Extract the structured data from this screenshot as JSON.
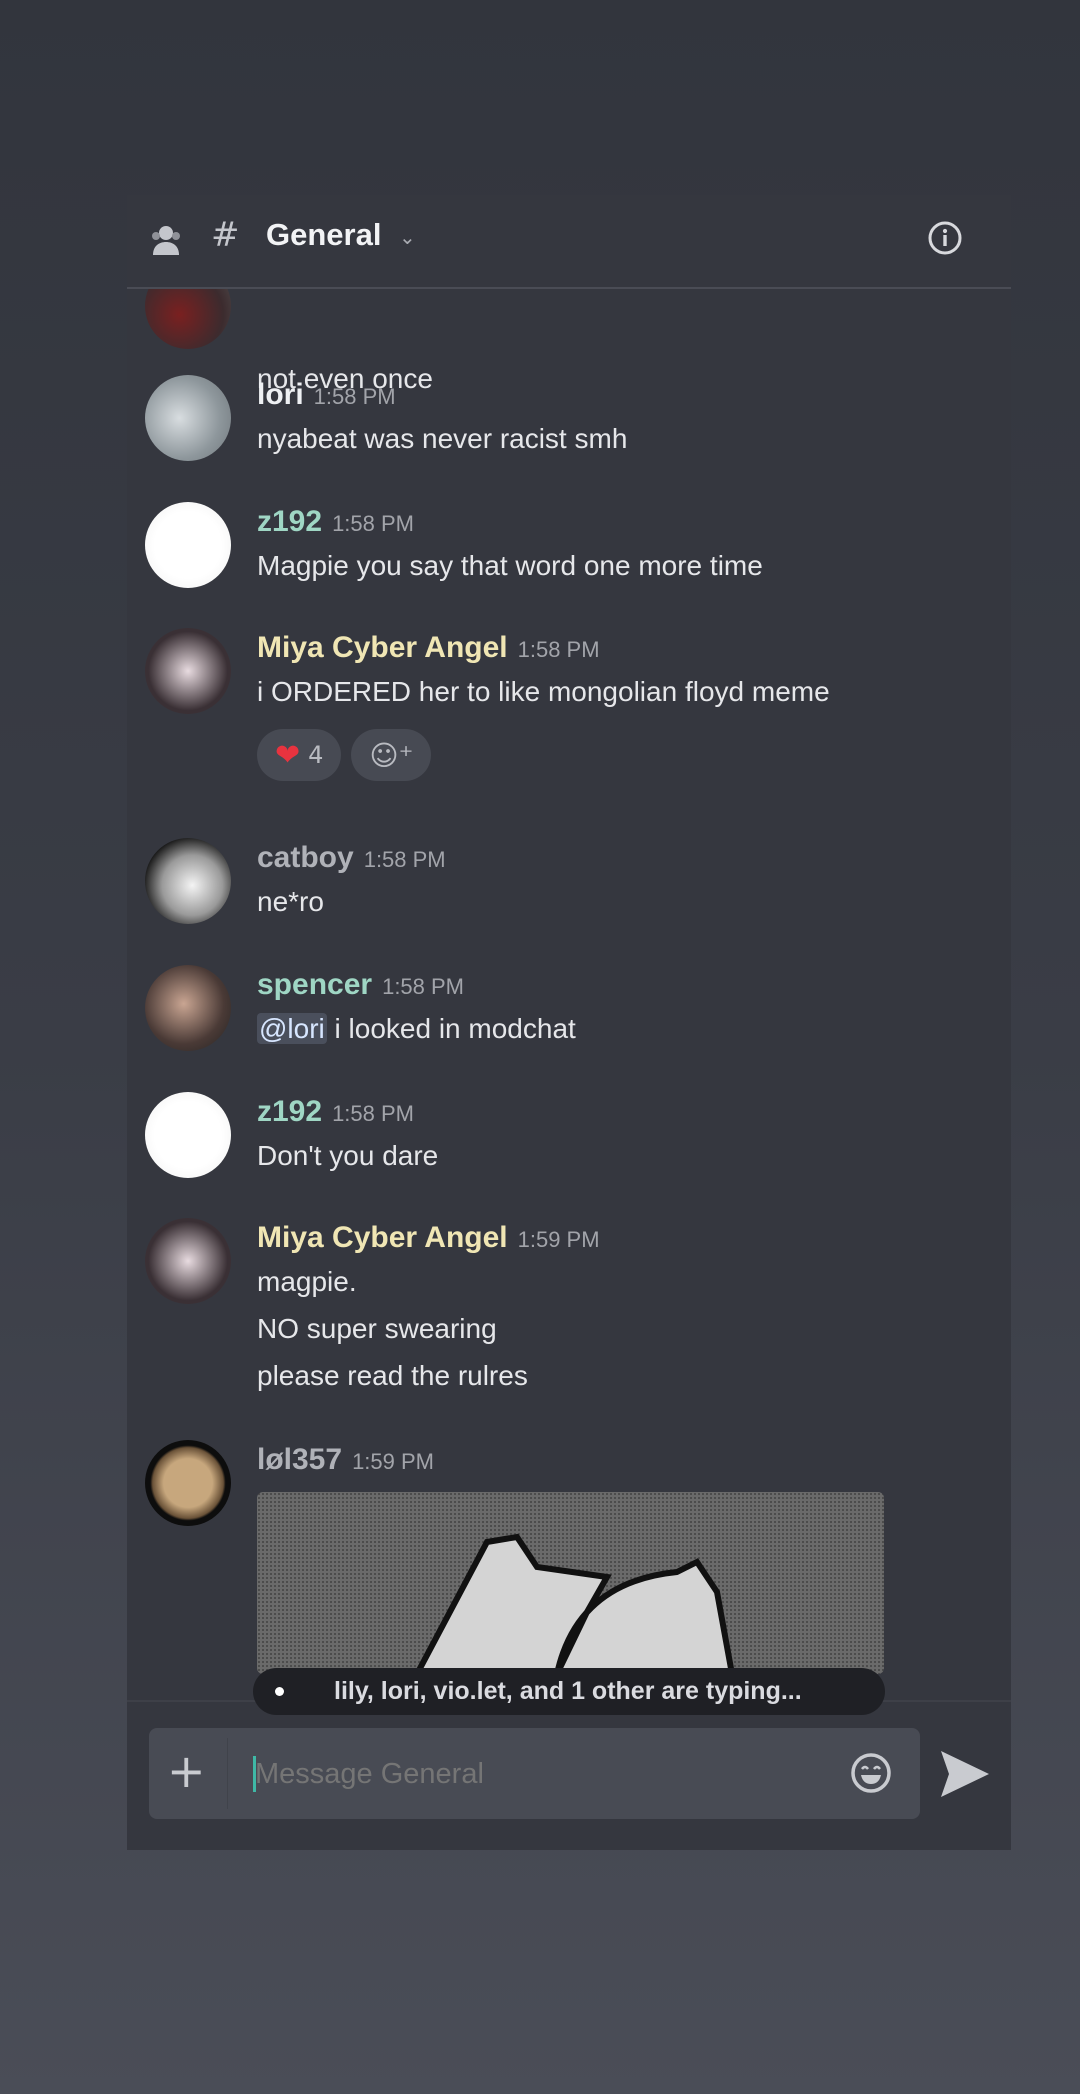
{
  "header": {
    "title": "General",
    "members_icon": "members-icon",
    "channel_icon": "hash-icon",
    "info_icon": "info-icon"
  },
  "messages": [
    {
      "text": "not even once"
    },
    {
      "author": "lori",
      "time": "1:58 PM",
      "color": "#eef0f3",
      "lines": [
        "nyabeat was never racist smh"
      ]
    },
    {
      "author": "z192",
      "time": "1:58 PM",
      "color": "#9fd6c4",
      "lines": [
        "Magpie you say that word one more time"
      ]
    },
    {
      "author": "Miya Cyber Angel",
      "time": "1:58 PM",
      "color": "#f0e6b4",
      "lines": [
        "i ORDERED her to like mongolian floyd meme"
      ],
      "reaction": {
        "emoji": "heart",
        "count": "4"
      }
    },
    {
      "author": "catboy",
      "time": "1:58 PM",
      "color": "#b0b2b8",
      "lines": [
        "ne*ro"
      ]
    },
    {
      "author": "spencer",
      "time": "1:58 PM",
      "color": "#9fd6c4",
      "mention": "@lori",
      "lines": [
        " i looked in modchat"
      ]
    },
    {
      "author": "z192",
      "time": "1:58 PM",
      "color": "#9fd6c4",
      "lines": [
        "Don't you dare"
      ]
    },
    {
      "author": "Miya Cyber Angel",
      "time": "1:59 PM",
      "color": "#f0e6b4",
      "lines": [
        "magpie.",
        "NO super swearing",
        "please read the rulres"
      ]
    },
    {
      "author": "løl357",
      "time": "1:59 PM",
      "color": "#b0b2b8"
    }
  ],
  "typing": "lily, lori, vio.let, and 1 other are typing...",
  "composer": {
    "placeholder": "Message General"
  }
}
